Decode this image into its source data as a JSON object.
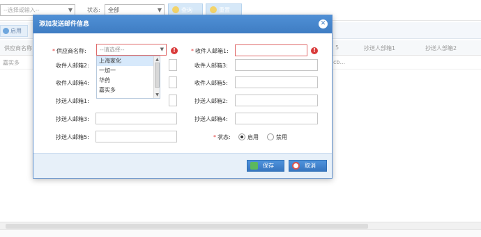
{
  "background": {
    "search_placeholder": "--选择或输入--",
    "status_label": "状态:",
    "status_value": "全部",
    "query_label": "查询",
    "reset_label": "重置",
    "enable_label": "启用",
    "columns": [
      "供应商名称",
      "5",
      "抄送人部箱1",
      "抄送人部箱2"
    ],
    "row": {
      "first": "嘉实多",
      "mid": "cb..."
    }
  },
  "modal": {
    "title": "添加发送邮件信息",
    "fields": {
      "supplier_label": "供应商名称:",
      "supplier_placeholder": "--请选择--",
      "recipient1_label": "收件人邮箱1:",
      "recipient2_label": "收件人邮箱2:",
      "recipient3_label": "收件人邮箱3:",
      "recipient4_label": "收件人邮箱4:",
      "recipient5_label": "收件人邮箱5:",
      "cc1_label": "抄送人邮箱1:",
      "cc2_label": "抄送人邮箱2:",
      "cc3_label": "抄送人邮箱3:",
      "cc4_label": "抄送人邮箱4:",
      "cc5_label": "抄送人邮箱5:",
      "status_label": "状态:",
      "enable_option": "启用",
      "disable_option": "禁用"
    },
    "dropdown_options": [
      "上海家化",
      "一加一",
      "华药",
      "嘉实多"
    ],
    "selected_option": "上海家化",
    "save_label": "保存",
    "cancel_label": "取消",
    "error_icon": "!"
  },
  "colors": {
    "header": "#3f7dc3",
    "error": "#d93a3a",
    "footer": "#e7f0f9"
  }
}
